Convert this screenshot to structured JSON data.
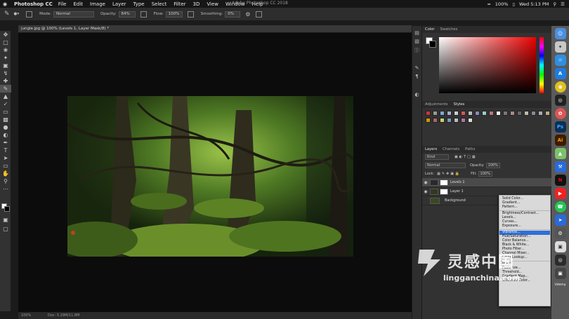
{
  "menubar": {
    "apple": "",
    "app": "Photoshop CC",
    "items": [
      "File",
      "Edit",
      "Image",
      "Layer",
      "Type",
      "Select",
      "Filter",
      "3D",
      "View",
      "Window",
      "Help"
    ],
    "battery": "100%",
    "clock": "Wed 5:13 PM"
  },
  "options": {
    "mode_label": "Mode:",
    "mode_value": "Normal",
    "opacity_label": "Opacity:",
    "opacity_value": "64%",
    "flow_label": "Flow:",
    "flow_value": "100%",
    "smoothing_label": "Smoothing:",
    "smoothing_value": "0%"
  },
  "window_title": "Adobe Photoshop CC 2018",
  "document": {
    "tab": "jungle.jpg @ 100% (Levels 1, Layer Mask/8) *",
    "zoom": "100%",
    "doc_size": "Doc: 5.29M/11.8M"
  },
  "color_panel": {
    "tabs": [
      "Color",
      "Swatches"
    ],
    "fg": "#ffffff",
    "bg": "#000000"
  },
  "styles_panel": {
    "tabs": [
      "Adjustments",
      "Styles"
    ]
  },
  "layers_panel": {
    "tabs": [
      "Layers",
      "Channels",
      "Paths"
    ],
    "filter": "Kind",
    "blend": "Normal",
    "opacity_label": "Opacity:",
    "opacity": "100%",
    "lock_label": "Lock:",
    "fill_label": "Fill:",
    "fill": "100%",
    "layers": [
      {
        "name": "Levels 1"
      },
      {
        "name": "Layer 1"
      },
      {
        "name": "Background"
      }
    ]
  },
  "adjust_menu": {
    "items": [
      "Solid Color...",
      "Gradient...",
      "Pattern...",
      "-",
      "Brightness/Contrast...",
      "Levels...",
      "Curves...",
      "Exposure...",
      "-",
      "Vibrance...",
      "Hue/Saturation...",
      "Color Balance...",
      "Black & White...",
      "Photo Filter...",
      "Channel Mixer...",
      "Color Lookup...",
      "-",
      "Invert",
      "Posterize...",
      "Threshold...",
      "Gradient Map...",
      "Selective Color..."
    ],
    "highlight": "Vibrance..."
  },
  "watermark": {
    "cn": "灵感中国",
    "url": "lingganchina.com"
  },
  "dock": [
    "Ps",
    "Ai"
  ],
  "udemy": "Udemy"
}
